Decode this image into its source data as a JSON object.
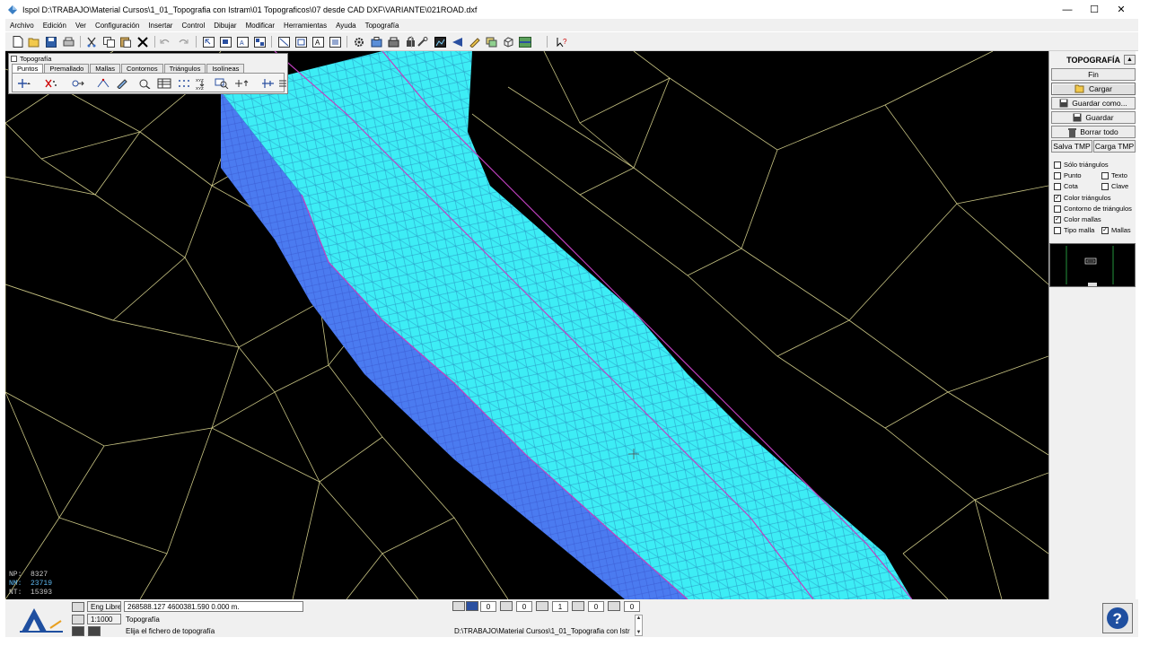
{
  "window": {
    "title": "Ispol  D:\\TRABAJO\\Material Cursos\\1_01_Topografia con Istram\\01 Topograficos\\07 desde CAD DXF\\VARIANTE\\021ROAD.dxf",
    "minimize_glyph": "—",
    "maximize_glyph": "☐",
    "close_glyph": "✕"
  },
  "menu": {
    "items": [
      "Archivo",
      "Edición",
      "Ver",
      "Configuración",
      "Insertar",
      "Control",
      "Dibujar",
      "Modificar",
      "Herramientas",
      "Ayuda",
      "Topografía"
    ]
  },
  "toolbar": {
    "icons": [
      "new-file-icon",
      "open-folder-icon",
      "save-icon",
      "print-icon",
      "cut-icon",
      "copy-icon",
      "paste-icon",
      "delete-icon",
      "undo-icon",
      "redo-icon",
      "select-window-icon",
      "zoom-window-icon",
      "zoom-all-icon",
      "zoom-previous-icon",
      "view-plan-icon",
      "view-frame-icon",
      "text-style-icon",
      "layer-icon",
      "settings-gear-icon",
      "export-icon",
      "printer-config-icon",
      "lock-icon",
      "tools-icon",
      "image-icon",
      "navigate-icon",
      "pencil-icon",
      "layers-icon",
      "cube-icon",
      "terrain-icon",
      "help-cursor-icon"
    ]
  },
  "topo_toolbar": {
    "title": "Topografía",
    "tabs": [
      "Puntos",
      "Premallado",
      "Mallas",
      "Contornos",
      "Triángulos",
      "Isolíneas"
    ],
    "active_tab": "Puntos"
  },
  "canvas": {
    "stats": [
      {
        "label": "NP:",
        "value": "8327"
      },
      {
        "label": "NM:",
        "value": "23719"
      },
      {
        "label": "NT:",
        "value": "15393"
      }
    ],
    "colors": {
      "background": "#000000",
      "terrain_lines": "#c8c483",
      "road_surface": "#3dedf5",
      "road_slope": "#4b7bf0",
      "breaklines": "#c040c0"
    }
  },
  "right_panel": {
    "title": "TOPOGRAFÍA",
    "collapse_glyph": "▲",
    "buttons": {
      "fin": "Fin",
      "cargar": "Cargar",
      "guardar_como": "Guardar como...",
      "guardar": "Guardar",
      "borrar_todo": "Borrar todo",
      "salva_tmp": "Salva TMP",
      "carga_tmp": "Carga TMP"
    },
    "checkboxes": {
      "solo_triangulos": {
        "label": "Sólo triángulos",
        "checked": false
      },
      "punto": {
        "label": "Punto",
        "checked": false
      },
      "texto": {
        "label": "Texto",
        "checked": false
      },
      "cota": {
        "label": "Cota",
        "checked": false
      },
      "clave": {
        "label": "Clave",
        "checked": false
      },
      "color_triangulos": {
        "label": "Color triángulos",
        "checked": true
      },
      "contorno_triangulos": {
        "label": "Contorno de triángulos",
        "checked": false
      },
      "color_mallas": {
        "label": "Color mallas",
        "checked": true
      },
      "tipo_malla": {
        "label": "Tipo malla",
        "checked": false
      },
      "mallas": {
        "label": "Mallas",
        "checked": true
      }
    },
    "check_glyph": "✓"
  },
  "status": {
    "mode": "Eng Libre",
    "coordinates": "268588.127  4600381.590    0.000     m.",
    "scale": "1:1000",
    "message_title": "Topografía",
    "message": "Elija el fichero de topografía",
    "path": "D:\\TRABAJO\\Material Cursos\\1_01_Topografia con Istr",
    "counters": [
      "0",
      "0",
      "1",
      "0",
      "0"
    ],
    "scroll_up": "▲",
    "scroll_down": "▼"
  }
}
